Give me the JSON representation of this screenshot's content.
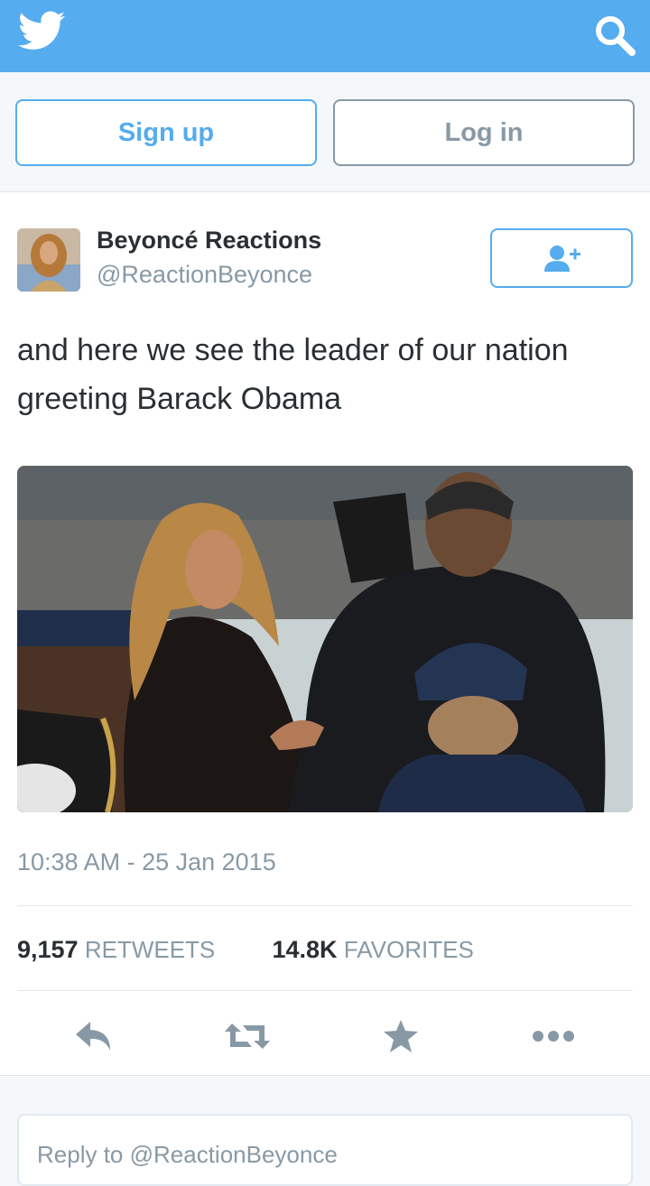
{
  "header": {
    "logo_icon": "twitter-bird-icon",
    "search_icon": "search-icon",
    "color": "#55acee"
  },
  "auth": {
    "signup_label": "Sign up",
    "login_label": "Log in"
  },
  "tweet": {
    "display_name": "Beyoncé Reactions",
    "handle": "@ReactionBeyonce",
    "follow_icon": "follow-user-icon",
    "text": "and here we see the leader of our nation greeting Barack Obama",
    "timestamp": "10:38 AM - 25 Jan 2015",
    "retweet_count": "9,157",
    "retweet_label": "RETWEETS",
    "favorite_count": "14.8K",
    "favorite_label": "FAVORITES",
    "actions": {
      "reply_icon": "reply-icon",
      "retweet_icon": "retweet-icon",
      "favorite_icon": "star-icon",
      "more_icon": "more-dots-icon"
    }
  },
  "reply": {
    "placeholder": "Reply to @ReactionBeyonce"
  }
}
